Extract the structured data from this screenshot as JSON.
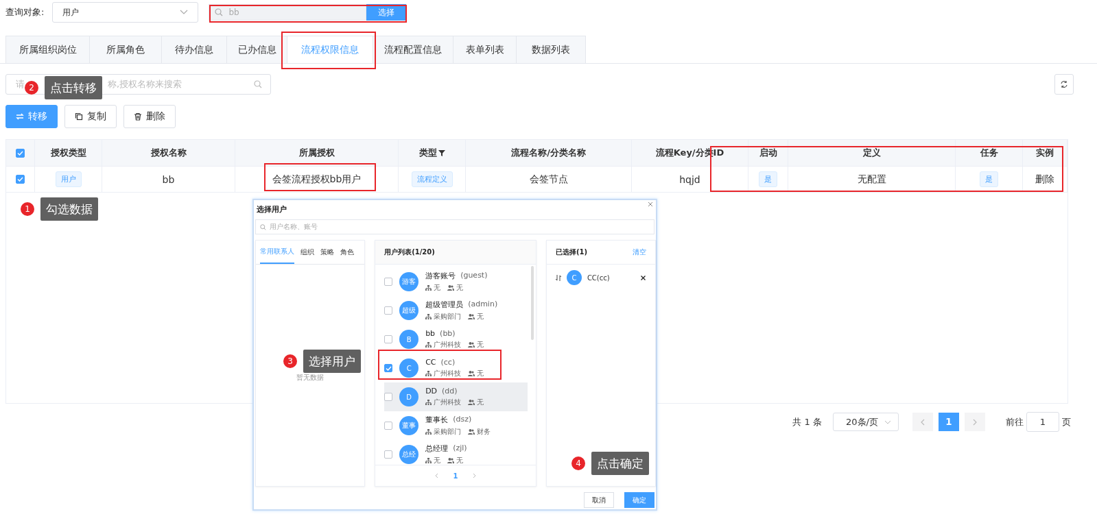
{
  "query": {
    "label": "查询对象:",
    "value": "用户"
  },
  "search": {
    "value": "bb",
    "button": "选择"
  },
  "tabs": [
    {
      "label": "所属组织岗位",
      "selected": false
    },
    {
      "label": "所属角色",
      "selected": false
    },
    {
      "label": "待办信息",
      "selected": false
    },
    {
      "label": "已办信息",
      "selected": false
    },
    {
      "label": "流程权限信息",
      "selected": true
    },
    {
      "label": "流程配置信息",
      "selected": false
    },
    {
      "label": "表单列表",
      "selected": false
    },
    {
      "label": "数据列表",
      "selected": false
    }
  ],
  "filter": {
    "placeholder_start": "请",
    "placeholder_end": "称,授权名称来搜索"
  },
  "toolbar": [
    {
      "label": "转移",
      "kind": "primary"
    },
    {
      "label": "复制",
      "kind": "copy"
    },
    {
      "label": "删除",
      "kind": "delete"
    }
  ],
  "table": {
    "all_checked": true,
    "columns": [
      {
        "label": "授权类型",
        "filter": false
      },
      {
        "label": "授权名称",
        "filter": false
      },
      {
        "label": "所属授权",
        "filter": false
      },
      {
        "label": "类型",
        "filter": true
      },
      {
        "label": "流程名称/分类名称",
        "filter": false
      },
      {
        "label": "流程Key/分类ID",
        "filter": false
      },
      {
        "label": "启动",
        "filter": false
      },
      {
        "label": "定义",
        "filter": false
      },
      {
        "label": "任务",
        "filter": false
      },
      {
        "label": "实例",
        "filter": false
      }
    ],
    "rows": [
      {
        "checked": true,
        "cells": [
          {
            "kind": "tag",
            "text": "用户"
          },
          {
            "kind": "text",
            "text": "bb"
          },
          {
            "kind": "text",
            "text": "会签流程授权bb用户"
          },
          {
            "kind": "tag",
            "text": "流程定义"
          },
          {
            "kind": "text",
            "text": "会签节点"
          },
          {
            "kind": "text",
            "text": "hqjd"
          },
          {
            "kind": "tag",
            "text": "是"
          },
          {
            "kind": "text",
            "text": "无配置"
          },
          {
            "kind": "tag",
            "text": "是"
          },
          {
            "kind": "text",
            "text": "删除"
          }
        ]
      }
    ]
  },
  "pagination": {
    "total": "共 1 条",
    "page_size": "20条/页",
    "pages": [
      {
        "label": "1",
        "selected": true
      }
    ],
    "goto_label": "前往",
    "goto_value": "1",
    "goto_suffix": "页"
  },
  "dialog": {
    "title": "选择用户",
    "search_placeholder": "用户名称、账号",
    "left_tabs": [
      {
        "label": "常用联系人",
        "selected": true
      },
      {
        "label": "组织",
        "selected": false
      },
      {
        "label": "策略",
        "selected": false
      },
      {
        "label": "角色",
        "selected": false
      }
    ],
    "left_empty": "暂无数据",
    "list_title": "用户列表(1/20)",
    "users": [
      {
        "avatar": "游客",
        "name": "游客账号",
        "account": "(guest)",
        "org": "无",
        "role": "无",
        "checked": false,
        "hovered": false
      },
      {
        "avatar": "超级",
        "name": "超级管理员",
        "account": "(admin)",
        "org": "采购部门",
        "role": "无",
        "checked": false,
        "hovered": false
      },
      {
        "avatar": "B",
        "name": "bb",
        "account": "(bb)",
        "org": "广州科技",
        "role": "无",
        "checked": false,
        "hovered": false
      },
      {
        "avatar": "C",
        "name": "CC",
        "account": "(cc)",
        "org": "广州科技",
        "role": "无",
        "checked": true,
        "hovered": false
      },
      {
        "avatar": "D",
        "name": "DD",
        "account": "(dd)",
        "org": "广州科技",
        "role": "无",
        "checked": false,
        "hovered": true
      },
      {
        "avatar": "董事",
        "name": "董事长",
        "account": "(dsz)",
        "org": "采购部门",
        "role": "财务",
        "checked": false,
        "hovered": false
      },
      {
        "avatar": "总经",
        "name": "总经理",
        "account": "(zjl)",
        "org": "无",
        "role": "无",
        "checked": false,
        "hovered": false
      }
    ],
    "list_page": "1",
    "selected_title": "已选择(1)",
    "clear": "清空",
    "selected": [
      {
        "avatar": "C",
        "label": "CC(cc)"
      }
    ],
    "cancel": "取消",
    "ok": "确定"
  },
  "callouts": [
    {
      "number": "2",
      "text": "点击转移"
    },
    {
      "number": "1",
      "text": "勾选数据"
    },
    {
      "number": "3",
      "text": "选择用户"
    },
    {
      "number": "4",
      "text": "点击确定"
    }
  ]
}
